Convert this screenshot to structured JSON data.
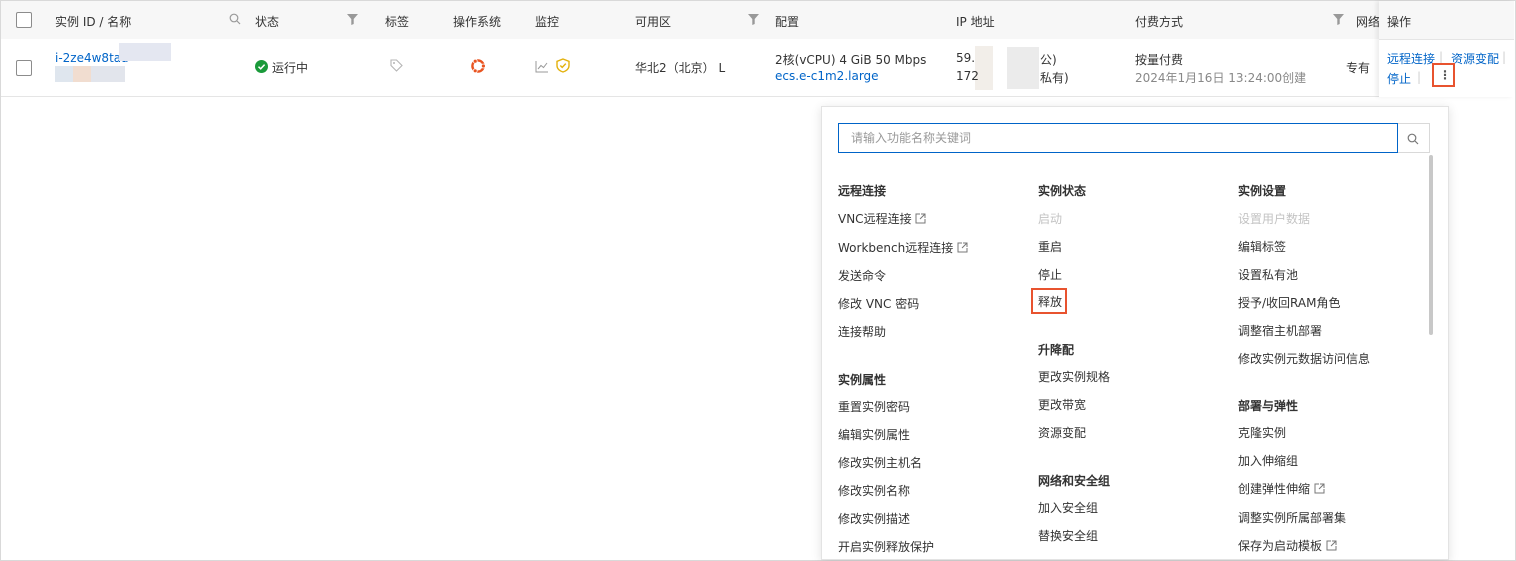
{
  "table": {
    "headers": {
      "instance": "实例 ID / 名称",
      "status": "状态",
      "tags": "标签",
      "os": "操作系统",
      "monitor": "监控",
      "zone": "可用区",
      "config": "配置",
      "ip": "IP 地址",
      "billing": "付费方式",
      "network": "网络",
      "actions": "操作"
    },
    "row": {
      "instance_id": "i-2ze4w8taa",
      "status": "运行中",
      "zone": "华北2（北京） L",
      "config_spec": "2核(vCPU)   4 GiB   50 Mbps",
      "config_type": "ecs.e-c1m2.large",
      "ip_public_prefix": "59.",
      "ip_public_suffix": "公)",
      "ip_private_prefix": "172",
      "ip_private_suffix": "私有)",
      "billing_type": "按量付费",
      "billing_created": "2024年1月16日 13:24:00创建",
      "network_partial": "专有",
      "action_remote": "远程连接",
      "action_resize": "资源变配",
      "action_stop": "停止",
      "action_more": "⋮",
      "separator": "|"
    }
  },
  "dropdown": {
    "search_placeholder": "请输入功能名称关键词",
    "col1": {
      "groups": [
        {
          "title": "远程连接",
          "items": [
            "VNC远程连接",
            "Workbench远程连接",
            "发送命令",
            "修改 VNC 密码",
            "连接帮助"
          ]
        },
        {
          "title": "实例属性",
          "items": [
            "重置实例密码",
            "编辑实例属性",
            "修改实例主机名",
            "修改实例名称",
            "修改实例描述",
            "开启实例释放保护"
          ]
        }
      ]
    },
    "col2": {
      "groups": [
        {
          "title": "实例状态",
          "items": [
            "启动",
            "重启",
            "停止",
            "释放"
          ]
        },
        {
          "title": "升降配",
          "items": [
            "更改实例规格",
            "更改带宽",
            "资源变配"
          ]
        },
        {
          "title": "网络和安全组",
          "items": [
            "加入安全组",
            "替换安全组"
          ]
        }
      ]
    },
    "col3": {
      "groups": [
        {
          "title": "实例设置",
          "items": [
            "设置用户数据",
            "编辑标签",
            "设置私有池",
            "授予/收回RAM角色",
            "调整宿主机部署",
            "修改实例元数据访问信息"
          ]
        },
        {
          "title": "部署与弹性",
          "items": [
            "克隆实例",
            "加入伸缩组",
            "创建弹性伸缩",
            "调整实例所属部署集",
            "保存为启动模板"
          ]
        }
      ]
    }
  },
  "colors": {
    "link": "#0064c8",
    "highlight": "#e8532f",
    "running": "#1a9a3a"
  }
}
